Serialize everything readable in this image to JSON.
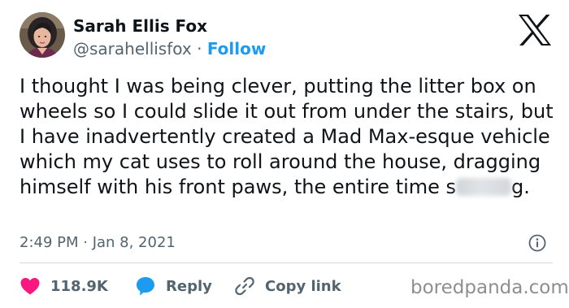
{
  "author": {
    "name": "Sarah Ellis Fox",
    "handle": "@sarahellisfox",
    "separator": "·",
    "follow_label": "Follow"
  },
  "tweet": {
    "text_before_blur": "I thought I was being clever, putting the litter box on wheels so I could slide it out from under the stairs, but I have inadvertently created a Mad Max-esque vehicle which my cat uses to roll around the house, dragging himself with his front paws, the entire time s",
    "text_after_blur": "g.",
    "timestamp": "2:49 PM · Jan 8, 2021"
  },
  "actions": {
    "likes_count": "118.9K",
    "reply_label": "Reply",
    "copy_link_label": "Copy link"
  },
  "watermark": "boredpanda.com",
  "colors": {
    "like": "#f91880",
    "reply": "#1d9bf0",
    "follow": "#1d9bf0",
    "secondary_text": "#536471"
  },
  "icons": {
    "brand": "x-logo-icon",
    "like": "heart-icon",
    "reply": "speech-bubble-icon",
    "copy": "link-icon",
    "info": "info-icon"
  }
}
